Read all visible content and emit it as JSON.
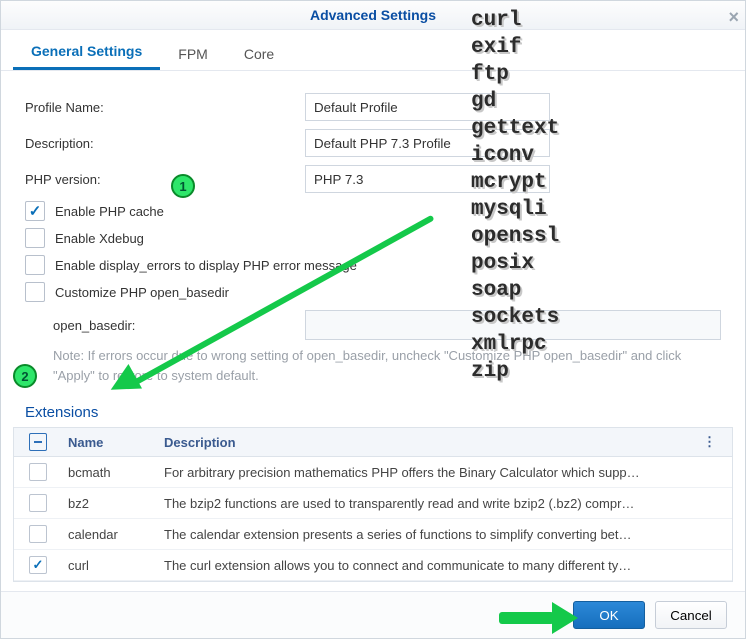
{
  "window": {
    "title": "Advanced Settings"
  },
  "tabs": {
    "general": "General Settings",
    "fpm": "FPM",
    "core": "Core"
  },
  "form": {
    "profile_label": "Profile Name:",
    "profile_value": "Default Profile",
    "desc_label": "Description:",
    "desc_value": "Default PHP 7.3 Profile",
    "ver_label": "PHP version:",
    "ver_value": "PHP 7.3",
    "enable_cache": "Enable PHP cache",
    "enable_xdebug": "Enable Xdebug",
    "display_errors": "Enable display_errors to display PHP error message",
    "customize_basedir": "Customize PHP open_basedir",
    "open_basedir_label": "open_basedir:",
    "note": "Note: If errors occur due to wrong setting of open_basedir, uncheck \"Customize PHP open_basedir\" and click \"Apply\" to restore to system default."
  },
  "extensions": {
    "title": "Extensions",
    "columns": {
      "name": "Name",
      "description": "Description"
    },
    "rows": [
      {
        "checked": false,
        "name": "bcmath",
        "desc": "For arbitrary precision mathematics PHP offers the Binary Calculator which supp…"
      },
      {
        "checked": false,
        "name": "bz2",
        "desc": "The bzip2 functions are used to transparently read and write bzip2 (.bz2) compr…"
      },
      {
        "checked": false,
        "name": "calendar",
        "desc": "The calendar extension presents a series of functions to simplify converting bet…"
      },
      {
        "checked": true,
        "name": "curl",
        "desc": "The curl extension allows you to connect and communicate to many different ty…"
      }
    ]
  },
  "buttons": {
    "ok": "OK",
    "cancel": "Cancel"
  },
  "overlay_ext_list": [
    "curl",
    "exif",
    "ftp",
    "gd",
    "gettext",
    "iconv",
    "mcrypt",
    "mysqli",
    "openssl",
    "posix",
    "soap",
    "sockets",
    "xmlrpc",
    "zip"
  ],
  "markers": {
    "m1": "1",
    "m2": "2"
  }
}
